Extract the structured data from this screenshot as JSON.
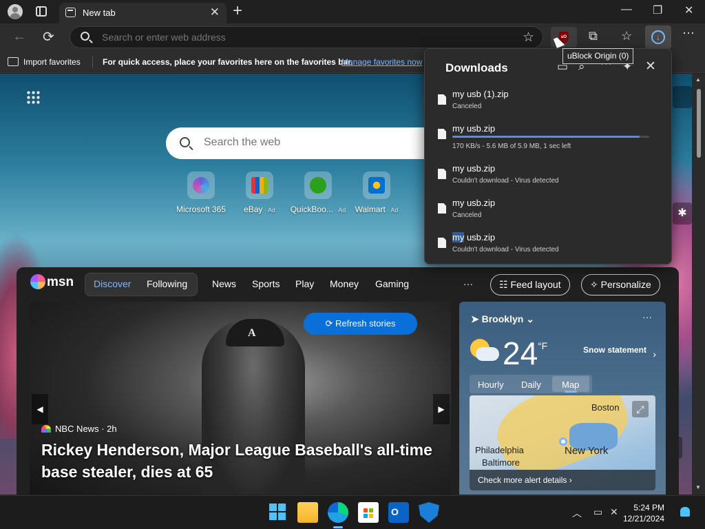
{
  "titlebar": {
    "tab_title": "New tab",
    "tab_close": "✕",
    "new_tab": "+",
    "minimize": "—",
    "restore": "❐",
    "close": "✕"
  },
  "navbar": {
    "back": "←",
    "refresh": "⟳",
    "address_placeholder": "Search or enter web address",
    "favorite_star": "☆",
    "extensions": "⧉",
    "favorites": "☆",
    "downloads": "↓",
    "more": "⋯",
    "ublock_badge": "uO"
  },
  "favorites_bar": {
    "import_label": "Import favorites",
    "hint": "For quick access, place your favorites here on the favorites bar.",
    "manage_link": "Manage favorites now"
  },
  "tooltip": "uBlock Origin (0)",
  "downloads_panel": {
    "title": "Downloads",
    "header_icons": [
      "folder-icon",
      "search-icon",
      "more-icon",
      "pin-icon",
      "close-icon"
    ],
    "items": [
      {
        "name": "my usb (1).zip",
        "status": "Canceled"
      },
      {
        "name": "my usb.zip",
        "status": "170 KB/s - 5.6 MB of 5.9 MB, 1 sec left",
        "progress": 0.95
      },
      {
        "name": "my usb.zip",
        "status": "Couldn't download - Virus detected"
      },
      {
        "name": "my usb.zip",
        "status": "Canceled"
      },
      {
        "name_highlight": "my",
        "name_rest": " usb.zip",
        "status": "Couldn't download - Virus detected"
      }
    ]
  },
  "newtab": {
    "search_placeholder": "Search the web",
    "quick_links": [
      {
        "label": "Microsoft 365",
        "ad": "",
        "color": "#6b5cd6"
      },
      {
        "label": "eBay",
        "ad": " · Ad",
        "color": "#e53238"
      },
      {
        "label": "QuickBoo...",
        "ad": " · Ad",
        "color": "#2ca01c"
      },
      {
        "label": "Walmart",
        "ad": " · Ad",
        "color": "#0071ce"
      }
    ]
  },
  "msn": {
    "logo": "msn",
    "tabs": {
      "discover": "Discover",
      "following": "Following"
    },
    "nav": [
      "News",
      "Sports",
      "Play",
      "Money",
      "Gaming"
    ],
    "more": "···",
    "feed_layout": "Feed layout",
    "personalize": "Personalize",
    "hero": {
      "refresh": "Refresh stories",
      "cap_letter": "A",
      "source": "NBC News",
      "time": "· 2h",
      "headline": "Rickey Henderson, Major League Baseball's all-time base stealer, dies at 65"
    },
    "weather": {
      "location": "Brooklyn",
      "temp": "24",
      "unit": "°F",
      "alert": "Snow statement",
      "tabs": [
        "Hourly",
        "Daily",
        "Map"
      ],
      "active_tab": "Map",
      "map_labels": {
        "boston": "Boston",
        "philadelphia": "Philadelphia",
        "baltimore": "Baltimore",
        "new_york": "New York"
      },
      "cta": "Check more alert details ›"
    }
  },
  "taskbar": {
    "clock_time": "5:24 PM",
    "clock_date": "12/21/2024",
    "outlook_letter": "O"
  },
  "colors": {
    "accent": "#7cb7ff",
    "refresh_button": "#0a6fd9",
    "progress": "#4d8ef0"
  }
}
